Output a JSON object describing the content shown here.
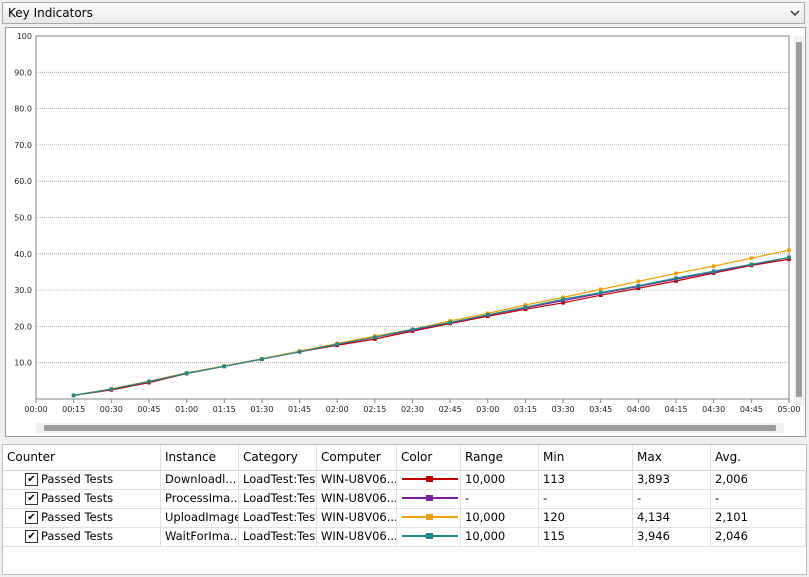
{
  "header": {
    "title": "Key Indicators"
  },
  "chart_data": {
    "type": "line",
    "x": [
      "00:00",
      "00:15",
      "00:30",
      "00:45",
      "01:00",
      "01:15",
      "01:30",
      "01:45",
      "02:00",
      "02:15",
      "02:30",
      "02:45",
      "03:00",
      "03:15",
      "03:30",
      "03:45",
      "04:00",
      "04:15",
      "04:30",
      "04:45",
      "05:00"
    ],
    "y_ticks": [
      "100",
      "90.0",
      "80.0",
      "70.0",
      "60.0",
      "50.0",
      "40.0",
      "30.0",
      "20.0",
      "10.0"
    ],
    "ylim": [
      0,
      100
    ],
    "grid": true,
    "series": [
      {
        "color": "#c00000",
        "values": [
          null,
          1,
          2.5,
          4.5,
          7,
          9,
          11,
          13,
          14.8,
          16.5,
          18.7,
          20.8,
          22.8,
          24.7,
          26.5,
          28.6,
          30.5,
          32.5,
          34.7,
          36.8,
          38.5
        ]
      },
      {
        "color": "#7b1fa2",
        "values": [
          null,
          1,
          2.7,
          4.8,
          7.1,
          9,
          11,
          13,
          15,
          17,
          19,
          21,
          23.1,
          25.1,
          27.1,
          29.1,
          31,
          33,
          35,
          37,
          39
        ]
      },
      {
        "color": "#f0a000",
        "values": [
          null,
          1,
          2.8,
          4.9,
          7.2,
          9.1,
          11.1,
          13.2,
          15.3,
          17.3,
          19.2,
          21.5,
          23.6,
          25.9,
          28,
          30.2,
          32.4,
          34.6,
          36.6,
          38.8,
          41
        ]
      },
      {
        "color": "#1a8a8a",
        "values": [
          null,
          1,
          2.7,
          4.8,
          7.1,
          9,
          11,
          13,
          15.1,
          17,
          19.2,
          21.1,
          23.2,
          25.3,
          27.5,
          29.3,
          31.2,
          33.3,
          35.2,
          37.1,
          39
        ]
      }
    ]
  },
  "table": {
    "columns": [
      "Counter",
      "Instance",
      "Category",
      "Computer",
      "Color",
      "Range",
      "Min",
      "Max",
      "Avg."
    ],
    "rows": [
      {
        "checked": "✔",
        "counter": "Passed Tests",
        "instance": "Downloadl...",
        "category": "LoadTest:Test",
        "computer": "WIN-U8V06...",
        "color": "#c00000",
        "range": "10,000",
        "min": "113",
        "max": "3,893",
        "avg": "2,006"
      },
      {
        "checked": "✔",
        "counter": "Passed Tests",
        "instance": "ProcessIma...",
        "category": "LoadTest:Test",
        "computer": "WIN-U8V06...",
        "color": "#7b1fa2",
        "range": "-",
        "min": "-",
        "max": "-",
        "avg": "-"
      },
      {
        "checked": "✔",
        "counter": "Passed Tests",
        "instance": "UploadImage",
        "category": "LoadTest:Test",
        "computer": "WIN-U8V06...",
        "color": "#f0a000",
        "range": "10,000",
        "min": "120",
        "max": "4,134",
        "avg": "2,101"
      },
      {
        "checked": "✔",
        "counter": "Passed Tests",
        "instance": "WaitForIma...",
        "category": "LoadTest:Test",
        "computer": "WIN-U8V06...",
        "color": "#1a8a8a",
        "range": "10,000",
        "min": "115",
        "max": "3,946",
        "avg": "2,046"
      }
    ]
  }
}
